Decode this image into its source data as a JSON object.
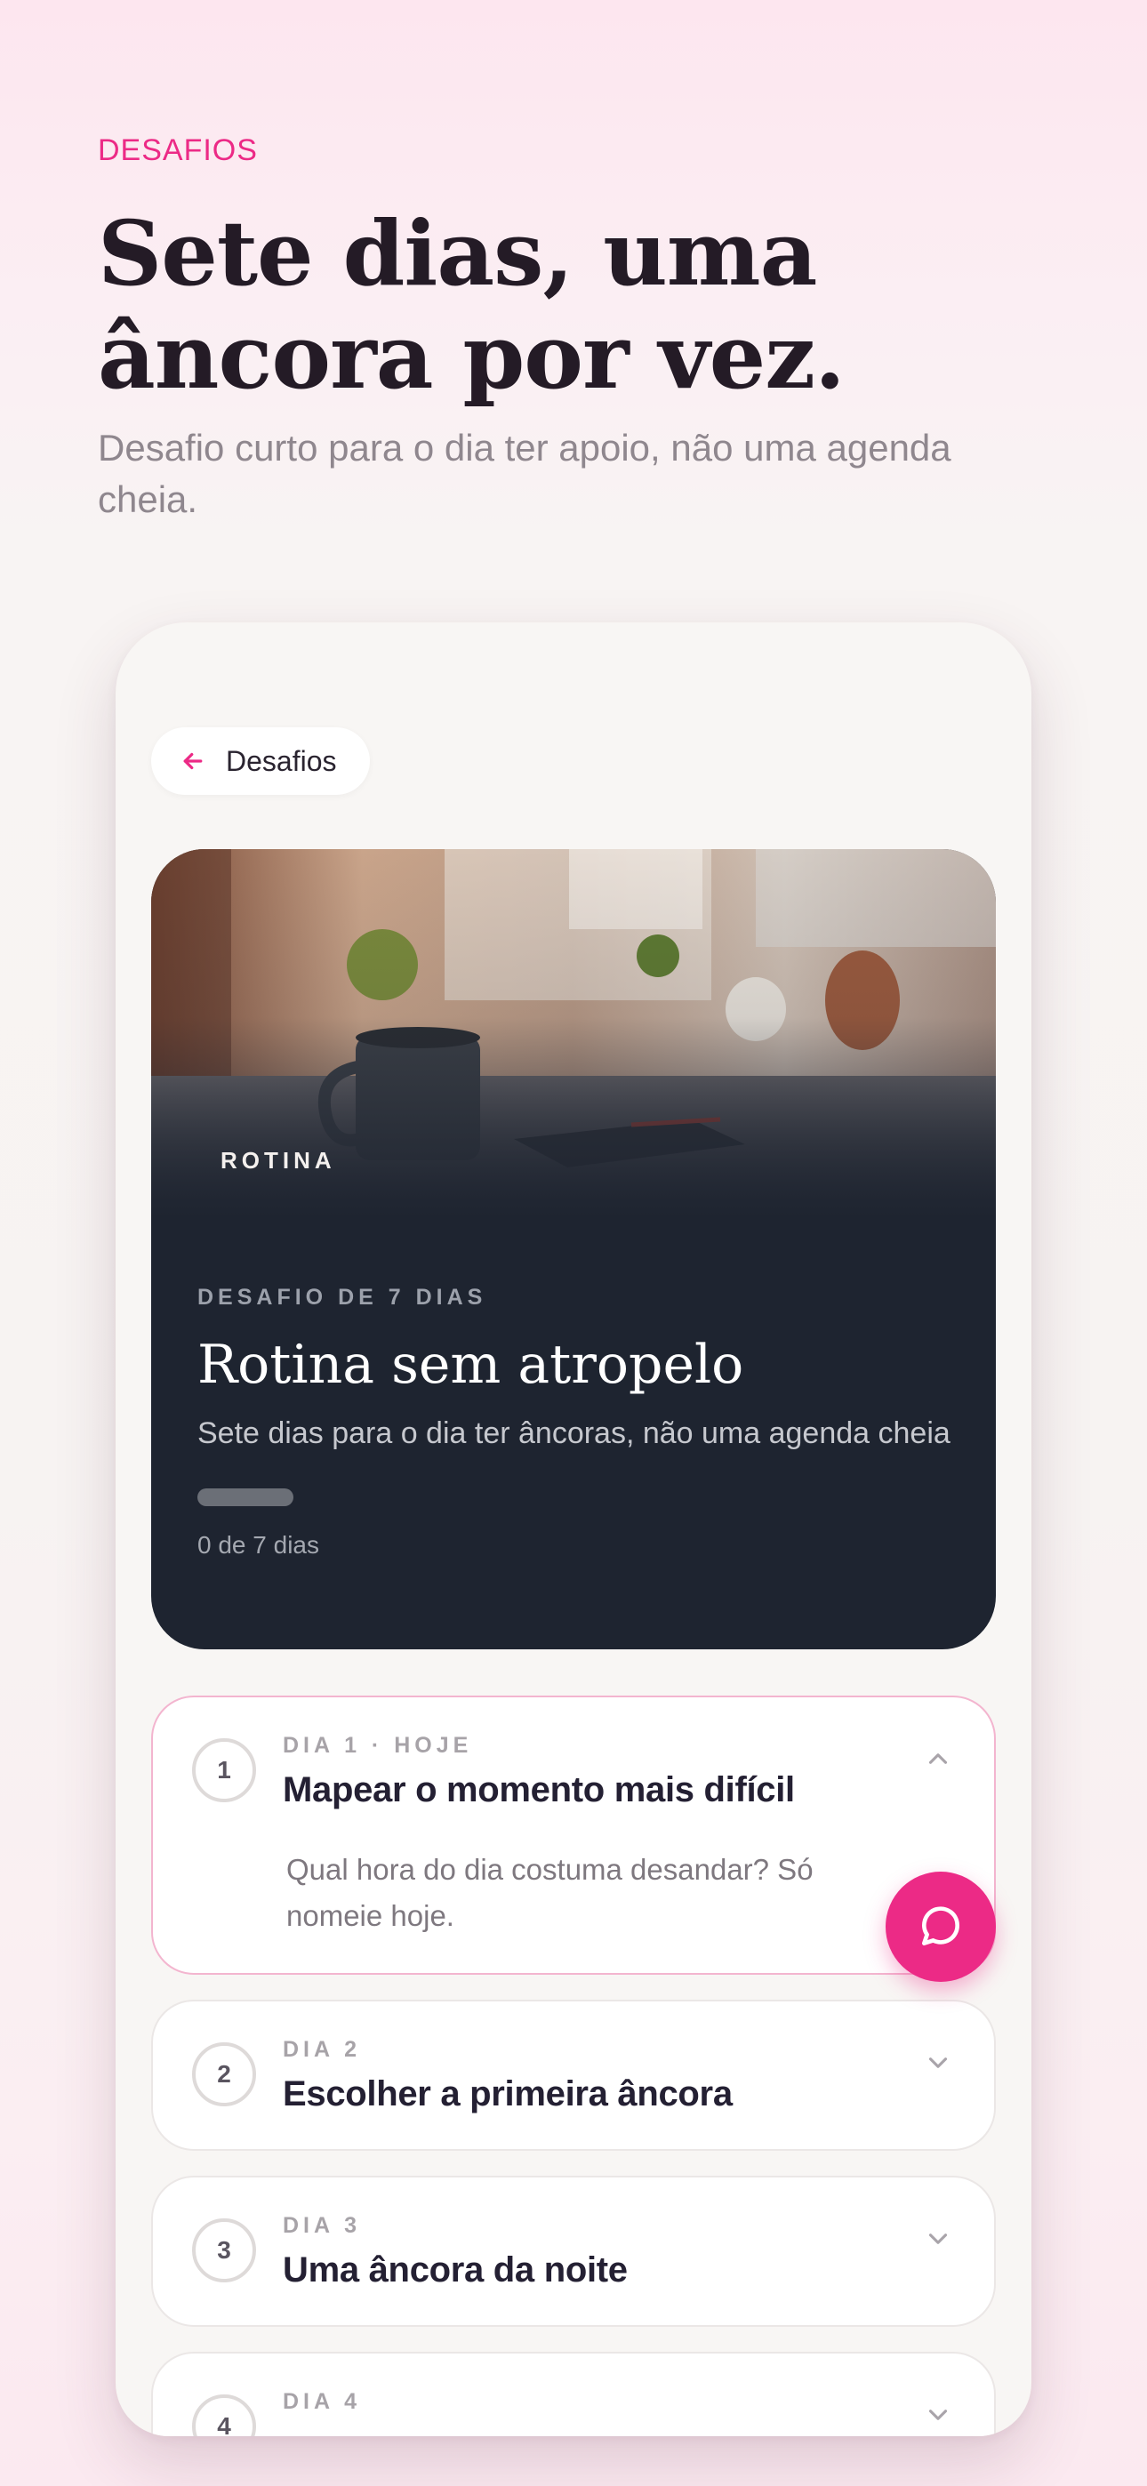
{
  "hero": {
    "eyebrow": "DESAFIOS",
    "title_line1": "Sete dias, uma",
    "title_line2": "âncora por vez.",
    "subtitle": "Desafio curto para o dia ter apoio, não uma agenda cheia."
  },
  "nav": {
    "back_label": "Desafios",
    "back_icon": "arrow-left-icon"
  },
  "challenge": {
    "photo_tag": "ROTINA",
    "kicker": "DESAFIO DE 7 DIAS",
    "title": "Rotina sem atropelo",
    "subtitle": "Sete dias para o dia ter âncoras, não uma agenda cheia",
    "progress_fraction": 0,
    "progress_text": "0 de 7 dias"
  },
  "days": [
    {
      "number": "1",
      "kicker": "DIA 1 · HOJE",
      "title": "Mapear o momento mais difícil",
      "description": "Qual hora do dia costuma desandar? Só nomeie hoje.",
      "expanded": true
    },
    {
      "number": "2",
      "kicker": "DIA 2",
      "title": "Escolher a primeira âncora",
      "expanded": false
    },
    {
      "number": "3",
      "kicker": "DIA 3",
      "title": "Uma âncora da noite",
      "expanded": false
    },
    {
      "number": "4",
      "kicker": "DIA 4",
      "title": "",
      "expanded": false
    }
  ],
  "fab": {
    "icon": "chat-bubble-icon"
  },
  "colors": {
    "accent": "#ec2a86",
    "card_dark": "#1e2430",
    "text_dark": "#242033"
  }
}
